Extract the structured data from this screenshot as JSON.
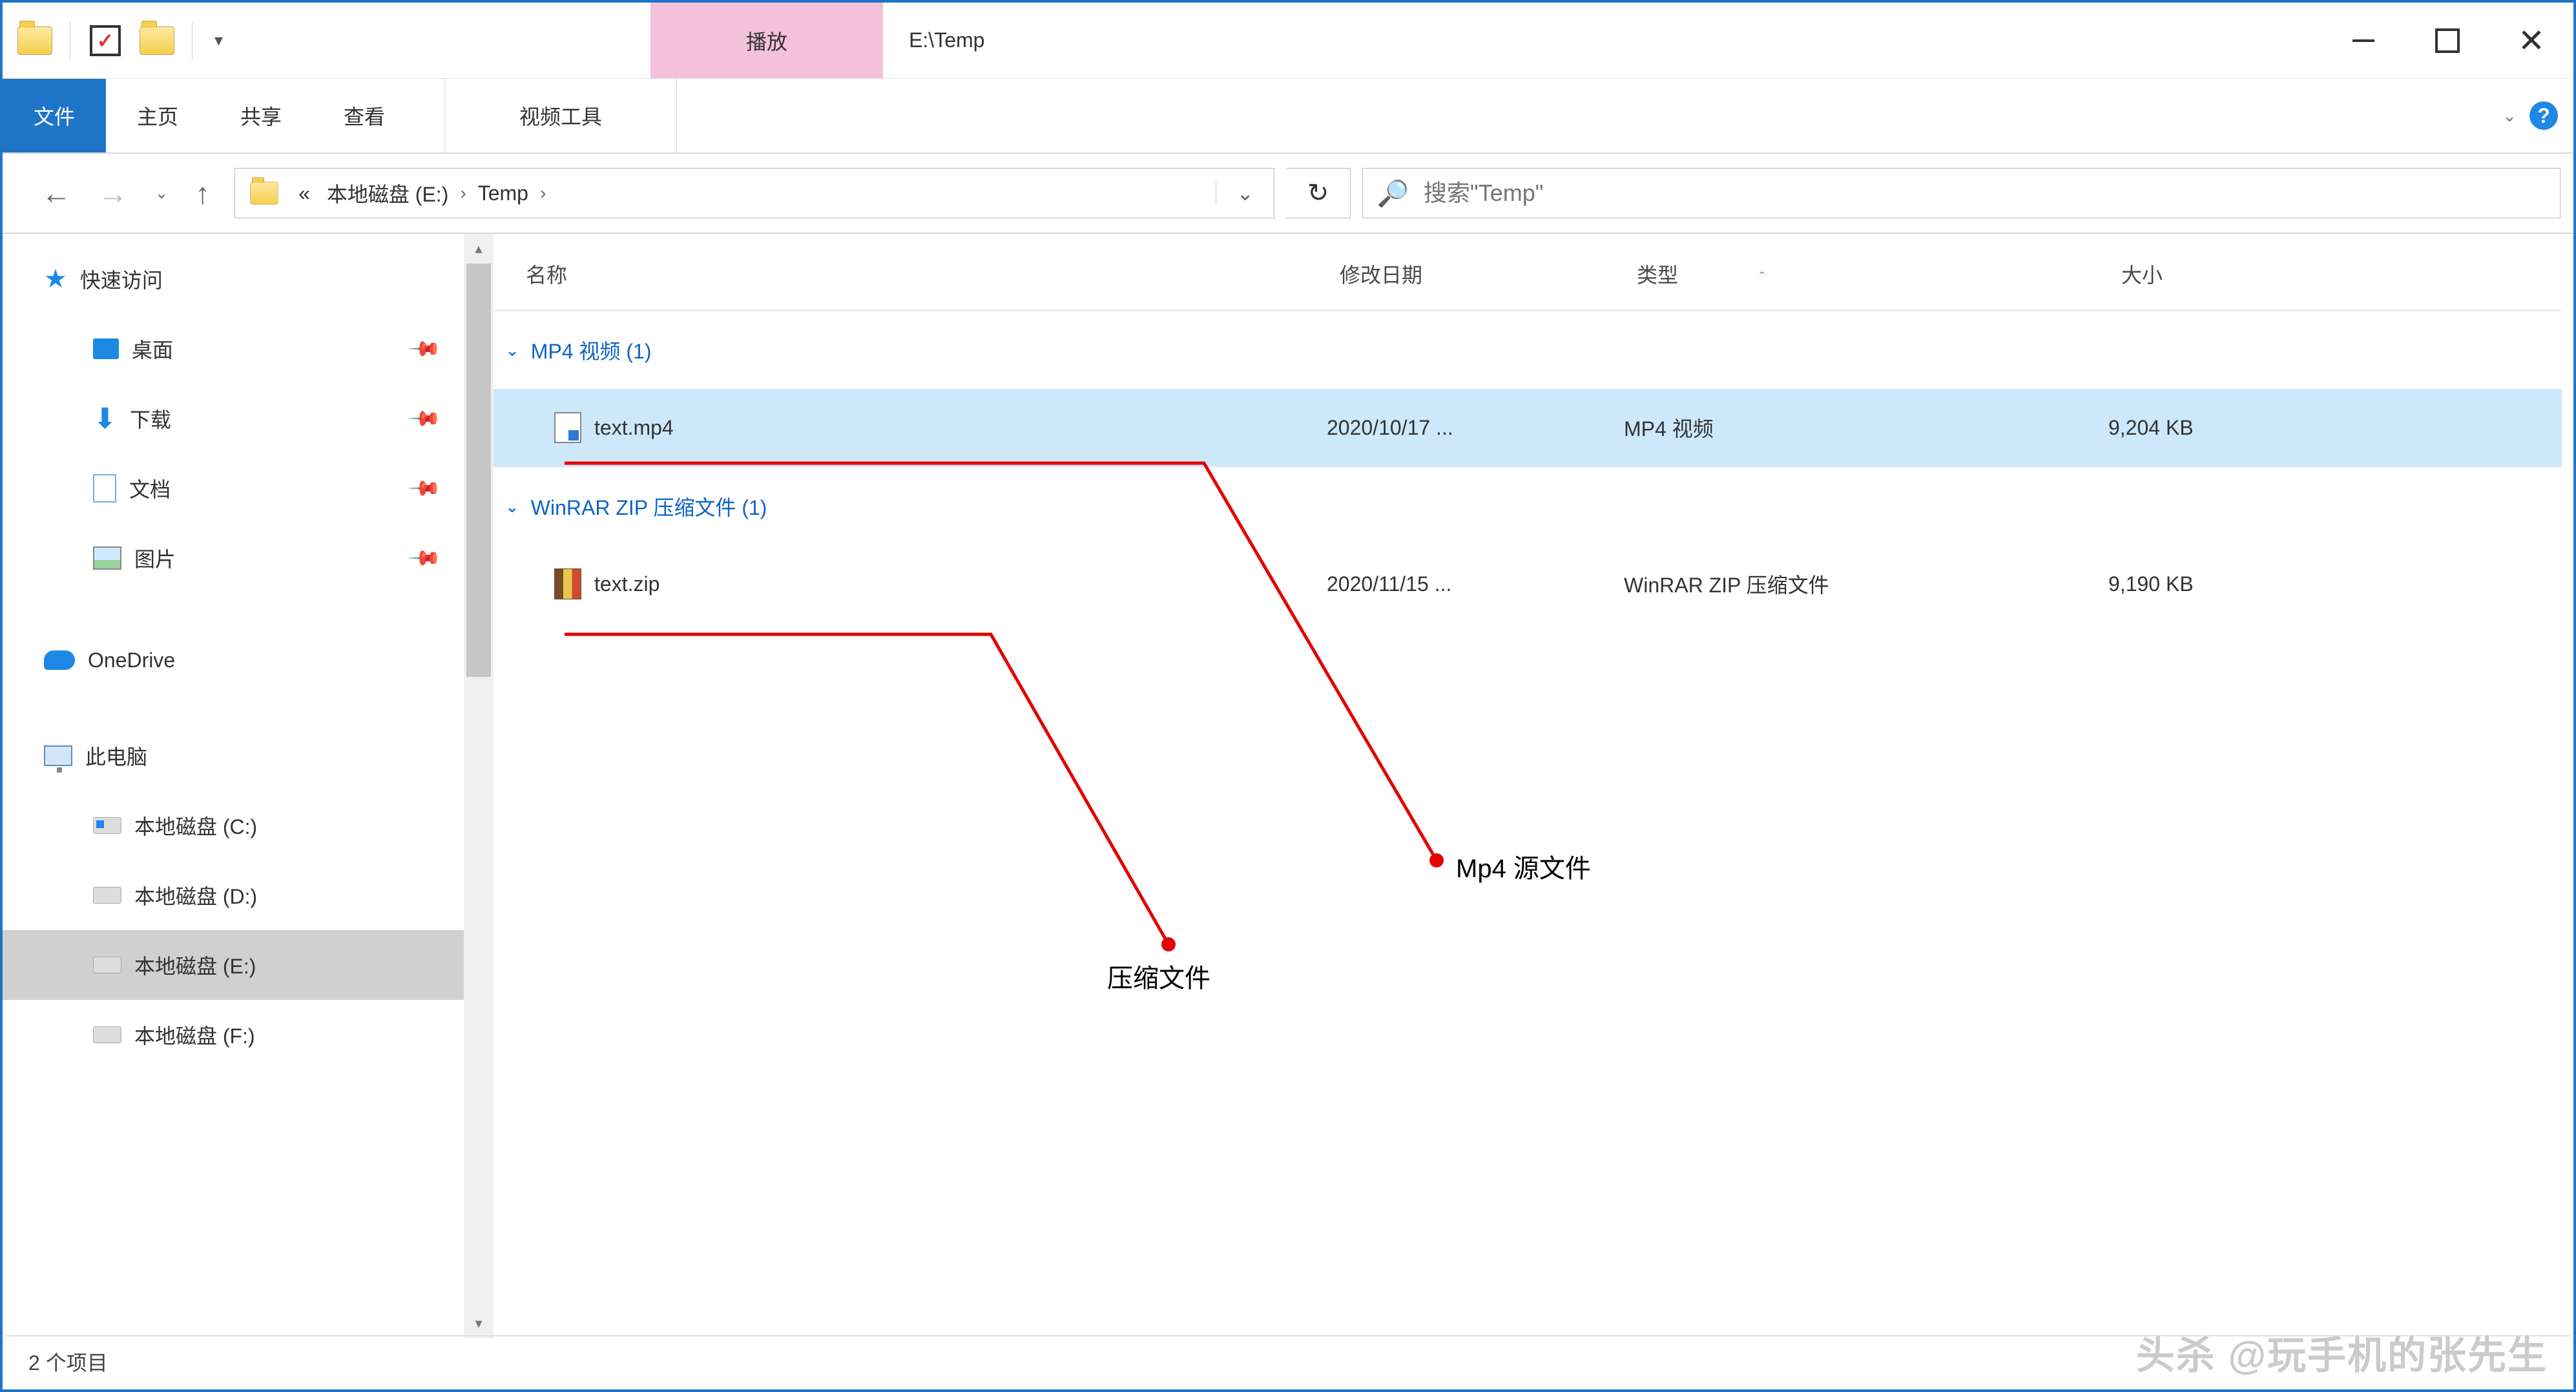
{
  "window": {
    "title": "E:\\Temp",
    "contextual_tab": "播放"
  },
  "ribbon": {
    "file": "文件",
    "home": "主页",
    "share": "共享",
    "view": "查看",
    "video_tools": "视频工具"
  },
  "address": {
    "quote_lead": "«",
    "crumb1": "本地磁盘 (E:)",
    "crumb2": "Temp"
  },
  "search": {
    "placeholder": "搜索\"Temp\""
  },
  "sidebar": {
    "quick_access": "快速访问",
    "desktop": "桌面",
    "downloads": "下载",
    "documents": "文档",
    "pictures": "图片",
    "onedrive": "OneDrive",
    "this_pc": "此电脑",
    "drive_c": "本地磁盘 (C:)",
    "drive_d": "本地磁盘 (D:)",
    "drive_e": "本地磁盘 (E:)",
    "drive_f": "本地磁盘 (F:)"
  },
  "columns": {
    "name": "名称",
    "date": "修改日期",
    "type": "类型",
    "size": "大小"
  },
  "groups": [
    {
      "header": "MP4 视频 (1)",
      "files": [
        {
          "name": "text.mp4",
          "date": "2020/10/17 ...",
          "type": "MP4 视频",
          "size": "9,204 KB"
        }
      ]
    },
    {
      "header": "WinRAR ZIP 压缩文件 (1)",
      "files": [
        {
          "name": "text.zip",
          "date": "2020/11/15 ...",
          "type": "WinRAR ZIP 压缩文件",
          "size": "9,190 KB"
        }
      ]
    }
  ],
  "annotations": {
    "source_label": "Mp4 源文件",
    "zip_label": "压缩文件"
  },
  "statusbar": {
    "text": "2 个项目"
  },
  "watermark": "头杀 @玩手机的张先生"
}
